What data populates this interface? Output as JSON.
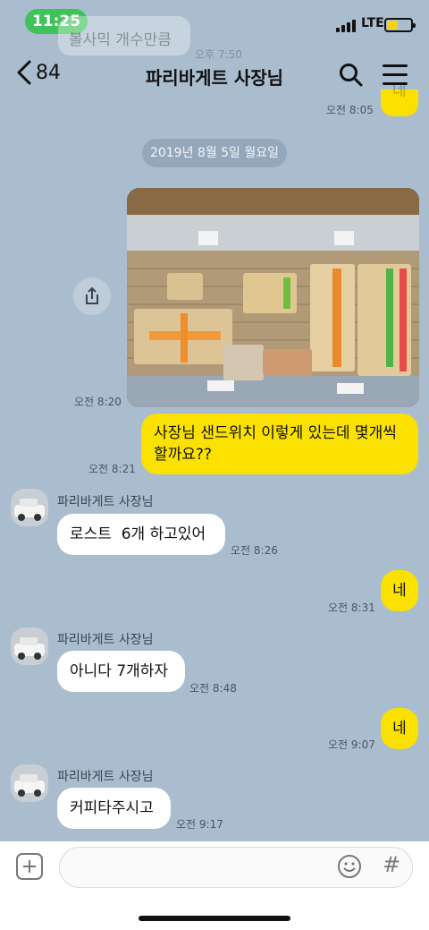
{
  "status_bar": {
    "time": "11:25",
    "network": "LTE"
  },
  "ghost": {
    "text": "볼사믹 개수만큼",
    "time": "오후 7:50"
  },
  "header": {
    "unread_count": "84",
    "title": "파리바게트 사장님"
  },
  "top_fragment": {
    "text": "네",
    "time": "오전 8:05"
  },
  "date_divider": "2019년 8월 5일 월요일",
  "messages": {
    "photo_time": "오전 8:20",
    "m1": {
      "text": "사장님 샌드위치 이렇게 있는데 몇개씩 할까요??",
      "time": "오전 8:21"
    },
    "r1": {
      "sender": "파리바게트 사장님",
      "text": "로스트  6개 하고있어",
      "time": "오전 8:26"
    },
    "m2": {
      "text": "네",
      "time": "오전 8:31"
    },
    "r2": {
      "sender": "파리바게트 사장님",
      "text": "아니다 7개하자",
      "time": "오전 8:48"
    },
    "m3": {
      "text": "네",
      "time": "오전 9:07"
    },
    "r3": {
      "sender": "파리바게트 사장님",
      "text": "커피타주시고",
      "time": "오전 9:17"
    }
  },
  "input": {
    "placeholder": ""
  },
  "colors": {
    "chat_bg": "#aabdcf",
    "my_bubble": "#fae100",
    "their_bubble": "#ffffff",
    "time_pill": "#3fc25a"
  }
}
